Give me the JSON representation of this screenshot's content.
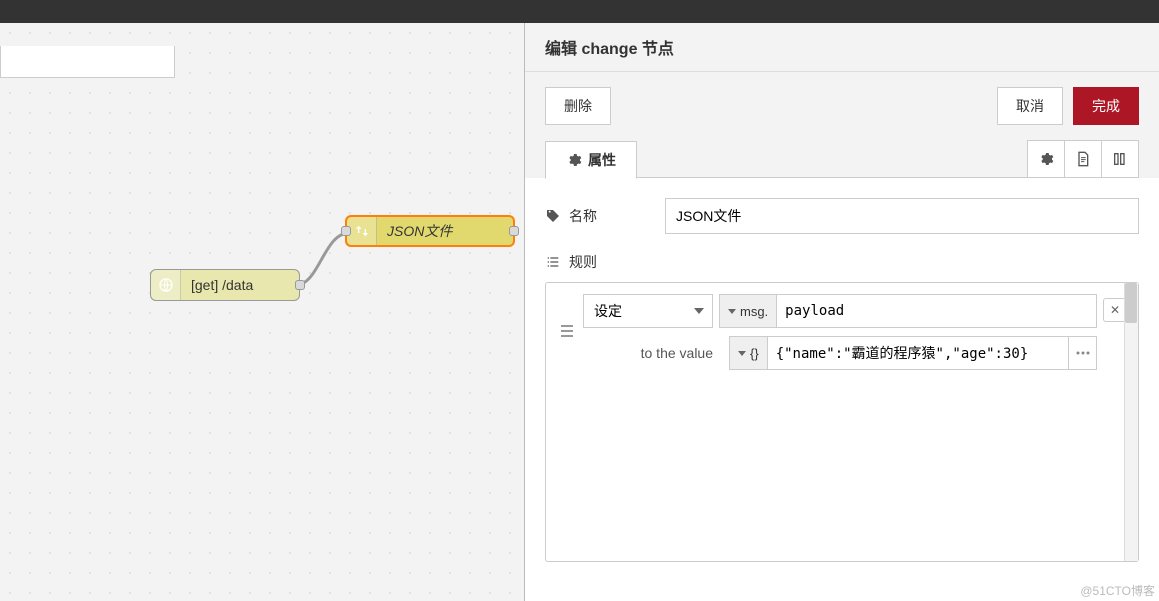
{
  "header": {
    "title": "编辑 change 节点"
  },
  "toolbar": {
    "delete": "删除",
    "cancel": "取消",
    "done": "完成"
  },
  "tabs": {
    "properties": "属性"
  },
  "form": {
    "name_label": "名称",
    "name_value": "JSON文件",
    "rules_label": "规则"
  },
  "rule": {
    "action": "设定",
    "msg_prefix": "msg.",
    "property": "payload",
    "to_label": "to the value",
    "json_type": "{}",
    "json_value": "{\"name\":\"霸道的程序猿\",\"age\":30}"
  },
  "canvas": {
    "http_node": "[get] /data",
    "change_node": "JSON文件"
  },
  "watermark": "@51CTO博客"
}
